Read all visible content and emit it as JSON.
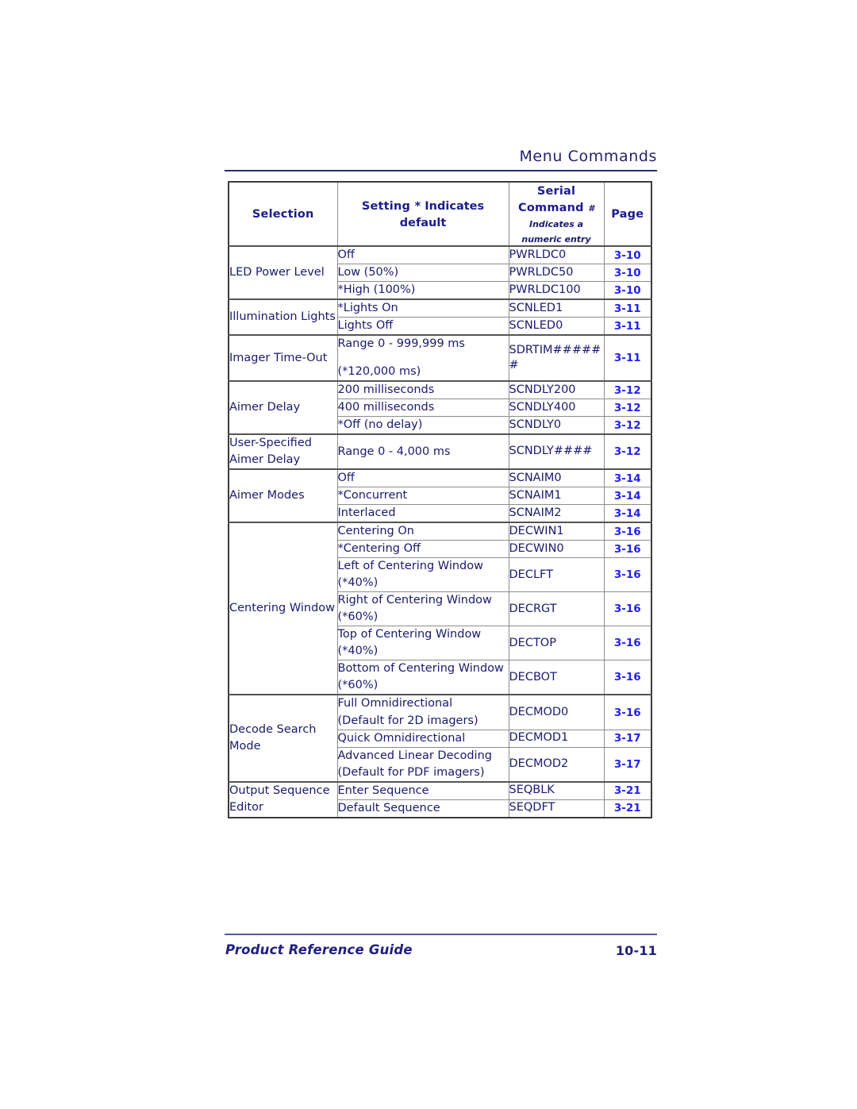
{
  "header": {
    "running_title": "Menu Commands"
  },
  "table": {
    "columns": [
      {
        "key": "selection",
        "label": "Selection"
      },
      {
        "key": "setting",
        "label": "Setting",
        "sub": "* Indicates default"
      },
      {
        "key": "command",
        "label_line1": "Serial",
        "label_line2": "Command",
        "note_line1": "# Indicates a",
        "note_line2": "numeric entry"
      },
      {
        "key": "page",
        "label": "Page"
      }
    ],
    "groups": [
      {
        "selection": "LED Power Level",
        "rows": [
          {
            "setting": "Off",
            "command": "PWRLDC0",
            "page": "3-10"
          },
          {
            "setting": "Low (50%)",
            "command": "PWRLDC50",
            "page": "3-10"
          },
          {
            "setting": "*High (100%)",
            "command": "PWRLDC100",
            "page": "3-10"
          }
        ]
      },
      {
        "selection": "Illumination Lights",
        "rows": [
          {
            "setting": "*Lights On",
            "command": "SCNLED1",
            "page": "3-11"
          },
          {
            "setting": "Lights Off",
            "command": "SCNLED0",
            "page": "3-11"
          }
        ]
      },
      {
        "selection": "Imager Time-Out",
        "rows": [
          {
            "setting_line1": "Range 0 - 999,999 ms",
            "setting_line2": "(*120,000 ms)",
            "command": "SDRTIM######",
            "page": "3-11"
          }
        ]
      },
      {
        "selection": "Aimer Delay",
        "rows": [
          {
            "setting": "200 milliseconds",
            "command": "SCNDLY200",
            "page": "3-12"
          },
          {
            "setting": "400 milliseconds",
            "command": "SCNDLY400",
            "page": "3-12"
          },
          {
            "setting": "*Off (no delay)",
            "command": "SCNDLY0",
            "page": "3-12"
          }
        ]
      },
      {
        "selection_line1": "User-Specified",
        "selection_line2": "Aimer Delay",
        "rows": [
          {
            "setting": "Range 0 - 4,000 ms",
            "command": "SCNDLY####",
            "page": "3-12"
          }
        ]
      },
      {
        "selection": "Aimer Modes",
        "rows": [
          {
            "setting": "Off",
            "command": "SCNAIM0",
            "page": "3-14"
          },
          {
            "setting": "*Concurrent",
            "command": "SCNAIM1",
            "page": "3-14"
          },
          {
            "setting": "Interlaced",
            "command": "SCNAIM2",
            "page": "3-14"
          }
        ]
      },
      {
        "selection": "Centering Window",
        "rows": [
          {
            "setting": "Centering On",
            "command": "DECWIN1",
            "page": "3-16"
          },
          {
            "setting": "*Centering Off",
            "command": "DECWIN0",
            "page": "3-16"
          },
          {
            "setting_line1": "Left of Centering Window",
            "setting_line2": "(*40%)",
            "command": "DECLFT",
            "page": "3-16"
          },
          {
            "setting_line1": "Right of Centering Window",
            "setting_line2": "(*60%)",
            "command": "DECRGT",
            "page": "3-16"
          },
          {
            "setting_line1": "Top of Centering Window",
            "setting_line2": "(*40%)",
            "command": "DECTOP",
            "page": "3-16"
          },
          {
            "setting_line1": "Bottom of Centering Window",
            "setting_line2": "(*60%)",
            "command": "DECBOT",
            "page": "3-16"
          }
        ]
      },
      {
        "selection_line1": "Decode Search",
        "selection_line2": "Mode",
        "rows": [
          {
            "setting_line1": "Full Omnidirectional",
            "setting_line2": "(Default for 2D imagers)",
            "command": "DECMOD0",
            "page": "3-16"
          },
          {
            "setting": "Quick Omnidirectional",
            "command": "DECMOD1",
            "page": "3-17"
          },
          {
            "setting_line1": "Advanced Linear Decoding",
            "setting_line2": "(Default for PDF imagers)",
            "command": "DECMOD2",
            "page": "3-17"
          }
        ]
      },
      {
        "selection_line1": "Output Sequence",
        "selection_line2": "Editor",
        "rows": [
          {
            "setting": "Enter Sequence",
            "command": "SEQBLK",
            "page": "3-21"
          },
          {
            "setting": "Default Sequence",
            "command": "SEQDFT",
            "page": "3-21"
          }
        ]
      }
    ]
  },
  "footer": {
    "guide_title": "Product Reference Guide",
    "page_number": "10-11"
  }
}
